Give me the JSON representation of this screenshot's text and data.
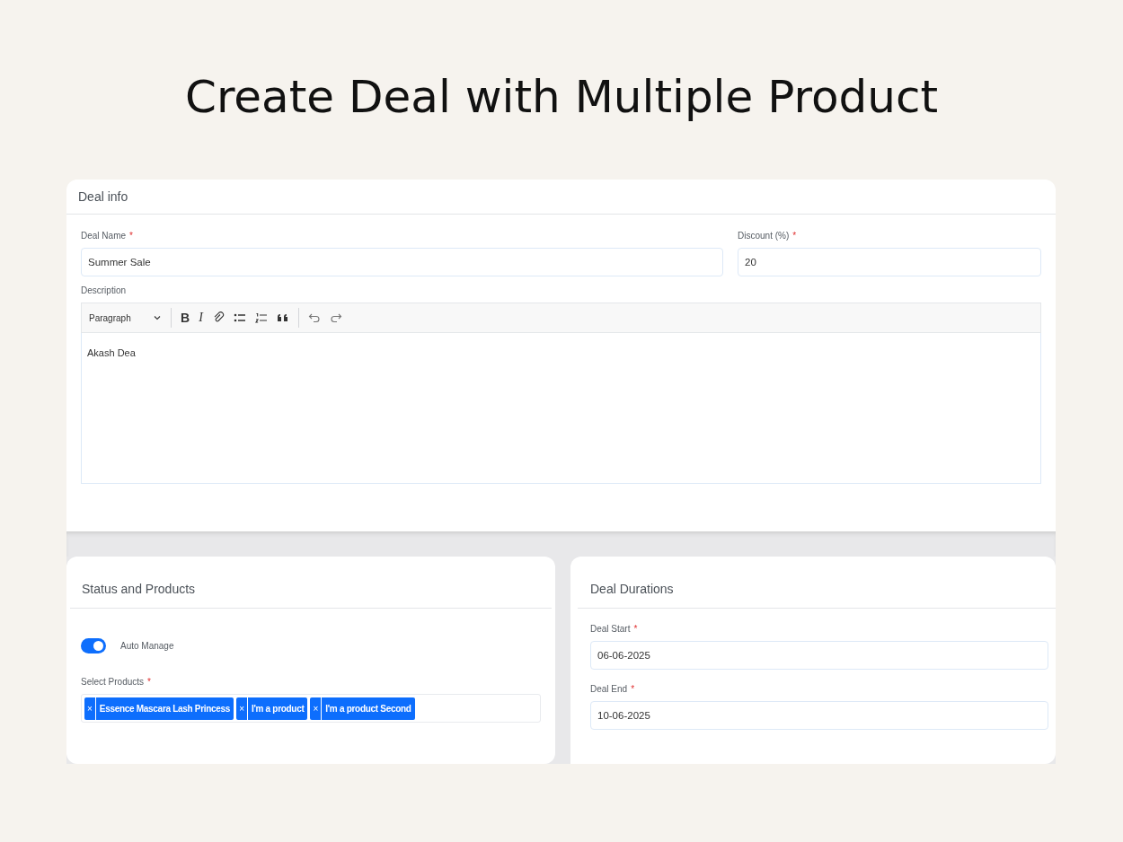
{
  "heading": "Create Deal with Multiple Product",
  "deal_info": {
    "title": "Deal info",
    "fields": [
      {
        "label": "Deal Name",
        "required_mark": "*",
        "value": "Summer Sale"
      },
      {
        "label": "Discount (%)",
        "required_mark": "*",
        "value": "20"
      }
    ],
    "description": {
      "label": "Description",
      "toolbar": [
        {
          "kind": "select",
          "label": "Paragraph"
        },
        {
          "kind": "divider"
        },
        {
          "kind": "bold",
          "label": "B"
        },
        {
          "kind": "italic",
          "label": "I"
        },
        {
          "kind": "link"
        },
        {
          "kind": "bullets"
        },
        {
          "kind": "numbers"
        },
        {
          "kind": "quote"
        },
        {
          "kind": "divider"
        },
        {
          "kind": "undo"
        },
        {
          "kind": "redo"
        }
      ],
      "content": "Akash Dea"
    }
  },
  "status_products": {
    "title": "Status and Products",
    "toggle": {
      "label": "Auto Manage",
      "on": true
    },
    "products": {
      "label": "Select Products",
      "required_mark": "*",
      "tags": [
        {
          "remove": "×",
          "label": "Essence Mascara Lash Princess"
        },
        {
          "remove": "×",
          "label": "I'm a product"
        },
        {
          "remove": "×",
          "label": "I'm a product Second"
        }
      ]
    }
  },
  "deal_durations": {
    "title": "Deal Durations",
    "fields": [
      {
        "label": "Deal Start",
        "required_mark": "*",
        "value": "06-06-2025"
      },
      {
        "label": "Deal End",
        "required_mark": "*",
        "value": "10-06-2025"
      }
    ]
  }
}
